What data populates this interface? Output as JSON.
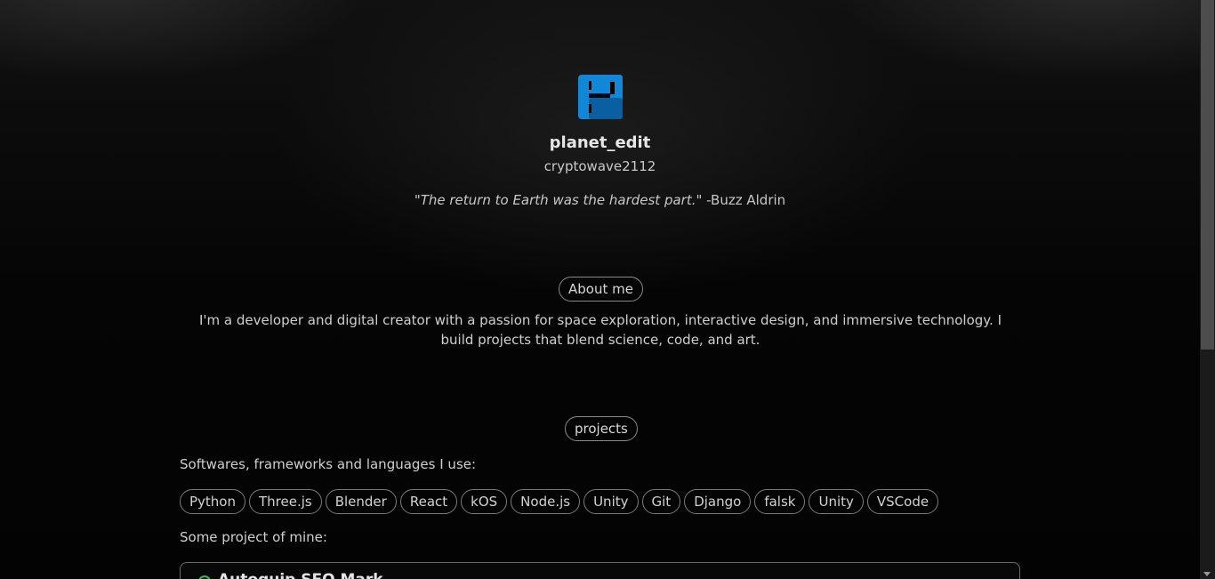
{
  "profile": {
    "name": "planet_edit",
    "handle": "cryptowave2112",
    "quote": "\"The return to Earth was the hardest part.\"",
    "quote_author": "-Buzz Aldrin",
    "logo_icon": "blue-E-logo",
    "logo_colors": [
      "#1287d8",
      "#0a5fa3"
    ]
  },
  "about": {
    "label": "About me",
    "text": "I'm a developer and digital creator with a passion for space exploration, interactive design, and immersive technology. I build projects that blend science, code, and art."
  },
  "projects": {
    "label": "projects",
    "tools_heading": "Softwares, frameworks and languages I use:",
    "tools": [
      "Python",
      "Three.js",
      "Blender",
      "React",
      "kOS",
      "Node.js",
      "Unity",
      "Git",
      "Django",
      "falsk",
      "Unity",
      "VSCode"
    ],
    "list_heading": "Some project of mine:",
    "cards": [
      {
        "title": "Autoquip SEO Mark",
        "status_color": "#2fbf4f"
      }
    ]
  }
}
